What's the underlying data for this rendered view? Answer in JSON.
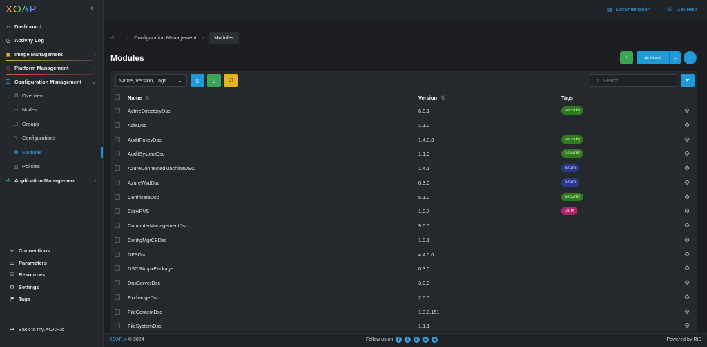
{
  "app": {
    "logo": "XOAP",
    "collapse_icon": "chevron-left-icon"
  },
  "sidebar": {
    "items": [
      {
        "label": "Dashboard",
        "icon": "home-icon",
        "glyph": "⌂"
      },
      {
        "label": "Activity Log",
        "icon": "clock-icon",
        "glyph": "◷"
      },
      {
        "label": "Image Management",
        "icon": "image-icon",
        "glyph": "▣",
        "color": "#e0b040",
        "chevron": "›"
      },
      {
        "label": "Platform Management",
        "icon": "cube-icon",
        "glyph": "◇",
        "color": "#e05a3a",
        "chevron": "›"
      },
      {
        "label": "Configuration Management",
        "icon": "sliders-icon",
        "glyph": "☰",
        "color": "#3aa0e0",
        "chevron": "⌄"
      }
    ],
    "sub_items": [
      {
        "label": "Overview",
        "icon": "chart-icon",
        "glyph": "▤"
      },
      {
        "label": "Nodes",
        "icon": "monitor-icon",
        "glyph": "▭"
      },
      {
        "label": "Groups",
        "icon": "folder-icon",
        "glyph": "▢"
      },
      {
        "label": "Configurations",
        "icon": "file-icon",
        "glyph": "▯"
      },
      {
        "label": "Modules",
        "icon": "module-icon",
        "glyph": "▦"
      },
      {
        "label": "Policies",
        "icon": "policy-icon",
        "glyph": "▥"
      }
    ],
    "after_items": [
      {
        "label": "Application Management",
        "icon": "apps-icon",
        "glyph": "✣",
        "color": "#55cc66",
        "chevron": "›"
      }
    ],
    "bottom_items": [
      {
        "label": "Connections",
        "icon": "link-icon",
        "glyph": "⚭"
      },
      {
        "label": "Parameters",
        "icon": "list-icon",
        "glyph": "☷"
      },
      {
        "label": "Resources",
        "icon": "database-icon",
        "glyph": "⛁"
      },
      {
        "label": "Settings",
        "icon": "gear-icon",
        "glyph": "⚙"
      },
      {
        "label": "Tags",
        "icon": "bookmark-icon",
        "glyph": "⚑"
      }
    ],
    "back_link": "Back to my.XOAP.io"
  },
  "topbar": {
    "documentation": "Documentation",
    "help": "Get Help"
  },
  "breadcrumb": {
    "parent": "Configuration Management",
    "current": "Modules"
  },
  "page": {
    "title": "Modules",
    "actions_label": "Actions",
    "info_label": "i"
  },
  "toolbar": {
    "column_select": "Name, Version, Tags",
    "search_placeholder": "Search"
  },
  "table": {
    "headers": {
      "name": "Name",
      "version": "Version",
      "tags": "Tags"
    },
    "rows": [
      {
        "name": "ActiveDirectoryDsc",
        "version": "6.0.1",
        "tag": "security"
      },
      {
        "name": "AdfsDsc",
        "version": "1.1.0",
        "tag": ""
      },
      {
        "name": "AuditPolicyDsc",
        "version": "1.4.0.0",
        "tag": "security"
      },
      {
        "name": "AuditSystemDsc",
        "version": "1.1.0",
        "tag": "security"
      },
      {
        "name": "AzureConnectedMachineDSC",
        "version": "1.4.1",
        "tag": "azure"
      },
      {
        "name": "AzureWvdDsc",
        "version": "0.3.0",
        "tag": "azure"
      },
      {
        "name": "CertificateDsc",
        "version": "5.1.0",
        "tag": "security"
      },
      {
        "name": "CitrixPVS",
        "version": "1.0.7",
        "tag": "citrix"
      },
      {
        "name": "ComputerManagementDsc",
        "version": "9.0.0",
        "tag": ""
      },
      {
        "name": "ConfigMgrCBDsc",
        "version": "1.0.1",
        "tag": ""
      },
      {
        "name": "DFSDsc",
        "version": "4.4.0.0",
        "tag": ""
      },
      {
        "name": "DSCRAppxPackage",
        "version": "0.3.0",
        "tag": ""
      },
      {
        "name": "DnsServerDsc",
        "version": "3.0.0",
        "tag": ""
      },
      {
        "name": "ExchangeDsc",
        "version": "2.0.0",
        "tag": ""
      },
      {
        "name": "FileContentDsc",
        "version": "1.3.0.151",
        "tag": ""
      },
      {
        "name": "FileSystemDsc",
        "version": "1.1.1",
        "tag": ""
      }
    ]
  },
  "tag_colors": {
    "security": {
      "bg": "#2f7a1e",
      "fg": "#d8f5c8"
    },
    "azure": {
      "bg": "#2a3a8a",
      "fg": "#c8d4ff"
    },
    "citrix": {
      "bg": "#b0226e",
      "fg": "#ffd6ec"
    }
  },
  "footer": {
    "brand": "XOAP.io",
    "copyright": "© 2024",
    "follow": "Follow us on",
    "powered": "Powered by RIS"
  }
}
